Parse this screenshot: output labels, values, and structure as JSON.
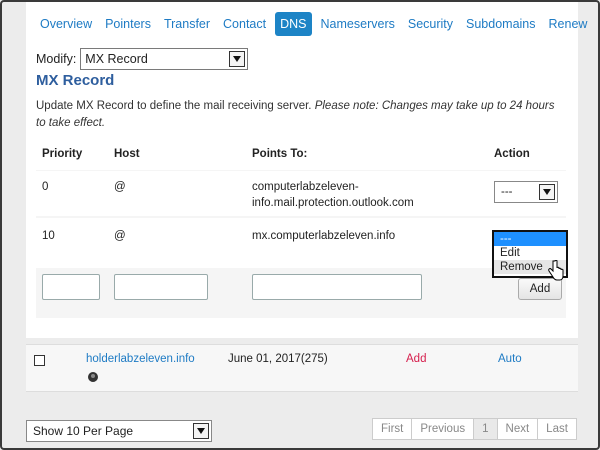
{
  "tabs": [
    "Overview",
    "Pointers",
    "Transfer",
    "Contact",
    "DNS",
    "Nameservers",
    "Security",
    "Subdomains",
    "Renew"
  ],
  "active_tab": "DNS",
  "modify": {
    "label": "Modify:",
    "value": "MX Record"
  },
  "section_title": "MX Record",
  "description": {
    "plain": "Update MX Record to define the mail receiving server. ",
    "note": "Please note: Changes may take up to 24 hours to take effect."
  },
  "table": {
    "headers": {
      "priority": "Priority",
      "host": "Host",
      "points_to": "Points To:",
      "action": "Action"
    },
    "rows": [
      {
        "priority": "0",
        "host": "@",
        "points_to": "computerlabzeleven-info.mail.protection.outlook.com",
        "action": "---"
      },
      {
        "priority": "10",
        "host": "@",
        "points_to": "mx.computerlabzeleven.info",
        "action": "---"
      }
    ],
    "add_label": "Add"
  },
  "action_dropdown": {
    "options": [
      "---",
      "Edit",
      "Remove"
    ],
    "selected": "---",
    "hover": "Remove"
  },
  "domain_row": {
    "name": "holderlabzeleven.info",
    "date": "June 01, 2017(275)",
    "add": "Add",
    "auto": "Auto"
  },
  "per_page": "Show 10 Per Page",
  "pagination": {
    "first": "First",
    "previous": "Previous",
    "current": "1",
    "next": "Next",
    "last": "Last"
  },
  "colors": {
    "link": "#1e7bc4",
    "active_tab": "#1d84c6",
    "title": "#2e5e9e",
    "add_red": "#d6204e"
  }
}
